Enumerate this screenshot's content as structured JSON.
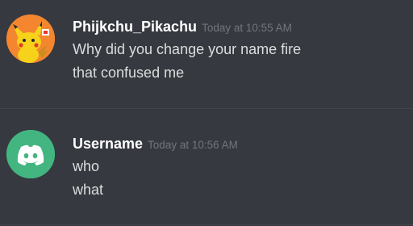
{
  "messages": [
    {
      "username": "Phijkchu_Pikachu",
      "timestamp": "Today at 10:55 AM",
      "lines": [
        "Why did you change your name fire",
        "that confused me"
      ],
      "avatar_icon": "pikachu-avatar-icon",
      "avatar_color": "#f3862f"
    },
    {
      "username": "Username",
      "timestamp": "Today at 10:56 AM",
      "lines": [
        "who",
        "what"
      ],
      "avatar_icon": "discord-logo-icon",
      "avatar_color": "#43b581"
    }
  ],
  "colors": {
    "background": "#36393f",
    "username": "#ffffff",
    "timestamp": "#72767d",
    "message_text": "#dcddde",
    "divider": "#42454b"
  }
}
